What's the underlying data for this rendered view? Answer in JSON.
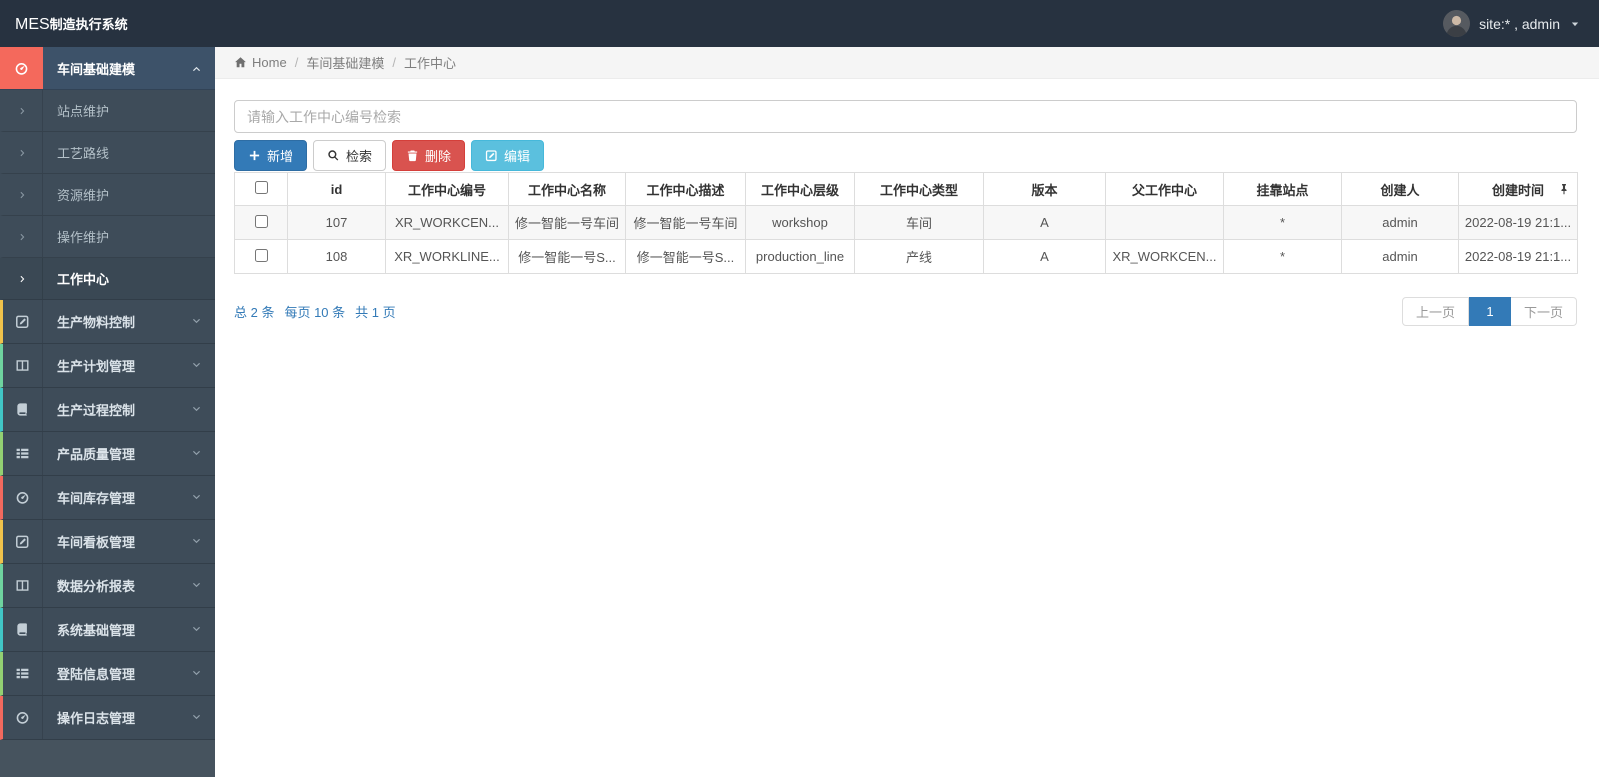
{
  "navbar": {
    "brand_bold": "MES",
    "brand_rest": "制造执行系统",
    "user_label": "site:* , admin"
  },
  "breadcrumb": {
    "separator": "/",
    "items": [
      {
        "label": "Home",
        "icon": "home-icon"
      },
      {
        "label": "车间基础建模"
      },
      {
        "label": "工作中心"
      }
    ]
  },
  "sidebar": {
    "groups": [
      {
        "label": "车间基础建模",
        "icon": "tachometer-icon",
        "expanded": true,
        "accent": "#f4695c",
        "children": [
          {
            "label": "站点维护"
          },
          {
            "label": "工艺路线"
          },
          {
            "label": "资源维护"
          },
          {
            "label": "操作维护"
          },
          {
            "label": "工作中心",
            "active": true
          }
        ]
      },
      {
        "label": "生产物料控制",
        "icon": "pencil-square-icon",
        "accent": "#f0c24b"
      },
      {
        "label": "生产计划管理",
        "icon": "columns-icon",
        "accent": "#6fd39f"
      },
      {
        "label": "生产过程控制",
        "icon": "book-icon",
        "accent": "#41c6c6"
      },
      {
        "label": "产品质量管理",
        "icon": "th-list-icon",
        "accent": "#93d072"
      },
      {
        "label": "车间库存管理",
        "icon": "tachometer-icon",
        "accent": "#f2695e"
      },
      {
        "label": "车间看板管理",
        "icon": "pencil-square-icon",
        "accent": "#f0c24b"
      },
      {
        "label": "数据分析报表",
        "icon": "columns-icon",
        "accent": "#6fd39f"
      },
      {
        "label": "系统基础管理",
        "icon": "book-icon",
        "accent": "#41c6c6"
      },
      {
        "label": "登陆信息管理",
        "icon": "th-list-icon",
        "accent": "#93d072"
      },
      {
        "label": "操作日志管理",
        "icon": "tachometer-icon",
        "accent": "#f2695e"
      }
    ]
  },
  "search": {
    "placeholder": "请输入工作中心编号检索",
    "value": ""
  },
  "toolbar": {
    "add_label": "新增",
    "search_label": "检索",
    "delete_label": "删除",
    "edit_label": "编辑"
  },
  "table": {
    "columns": [
      "id",
      "工作中心编号",
      "工作中心名称",
      "工作中心描述",
      "工作中心层级",
      "工作中心类型",
      "版本",
      "父工作中心",
      "挂靠站点",
      "创建人",
      "创建时间"
    ],
    "rows": [
      {
        "selected": false,
        "cells": [
          "107",
          "XR_WORKCEN...",
          "修一智能一号车间",
          "修一智能一号车间",
          "workshop",
          "车间",
          "A",
          "",
          "*",
          "admin",
          "2022-08-19 21:1..."
        ]
      },
      {
        "selected": false,
        "cells": [
          "108",
          "XR_WORKLINE...",
          "修一智能一号S...",
          "修一智能一号S...",
          "production_line",
          "产线",
          "A",
          "XR_WORKCEN...",
          "*",
          "admin",
          "2022-08-19 21:1..."
        ]
      }
    ]
  },
  "pagination": {
    "summary": [
      "总 2 条",
      "每页 10 条",
      "共 1 页"
    ],
    "prev_label": "上一页",
    "current_page": "1",
    "next_label": "下一页"
  },
  "colors": {
    "primary": "#337ab7",
    "danger": "#d9534f",
    "info": "#5bc0de",
    "active_accent": "#f4695c",
    "navbar_bg": "#273240",
    "sidebar_bg": "#3e4c59"
  }
}
